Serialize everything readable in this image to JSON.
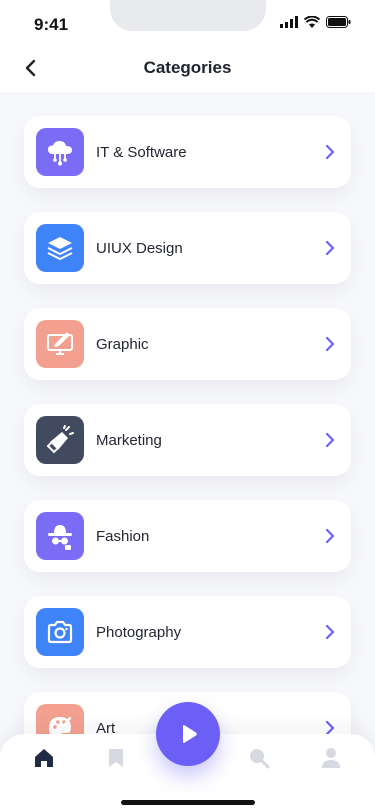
{
  "status_bar": {
    "time": "9:41"
  },
  "header": {
    "title": "Categories"
  },
  "categories": [
    {
      "label": "IT & Software",
      "icon": "cloud-network-icon",
      "color": "#7b6cf6"
    },
    {
      "label": "UIUX Design",
      "icon": "layers-icon",
      "color": "#3f83f8"
    },
    {
      "label": "Graphic",
      "icon": "monitor-brush-icon",
      "color": "#f4a090"
    },
    {
      "label": "Marketing",
      "icon": "megaphone-icon",
      "color": "#414a5f"
    },
    {
      "label": "Fashion",
      "icon": "hat-sunglasses-icon",
      "color": "#7b6cf6"
    },
    {
      "label": "Photography",
      "icon": "camera-icon",
      "color": "#3f83f8"
    },
    {
      "label": "Art",
      "icon": "palette-icon",
      "color": "#f4a090"
    }
  ],
  "tab_bar": {
    "items": [
      {
        "icon": "home-icon",
        "active": true
      },
      {
        "icon": "bookmark-icon",
        "active": false
      },
      {
        "icon": "search-icon",
        "active": false
      },
      {
        "icon": "profile-icon",
        "active": false
      }
    ],
    "fab_icon": "play-icon",
    "accent": "#6b5ff6"
  }
}
